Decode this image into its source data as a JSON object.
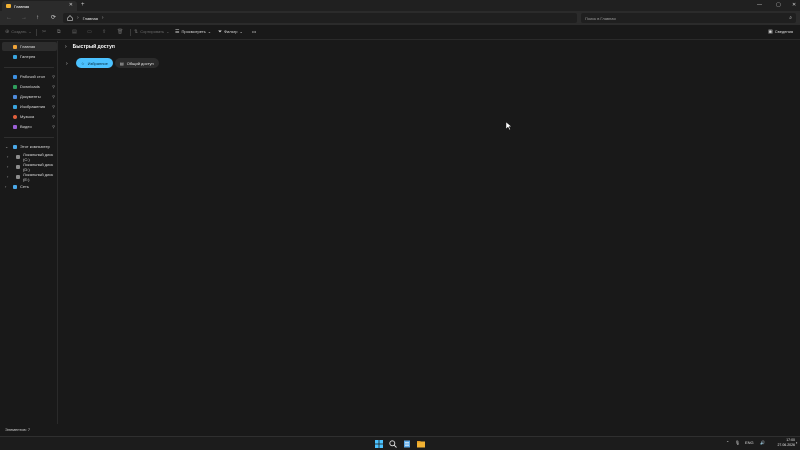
{
  "window": {
    "tab_title": "Главная",
    "tab_close": "✕",
    "new_tab": "+",
    "controls": {
      "minimize": "—",
      "maximize": "▢",
      "close": "✕"
    }
  },
  "addressbar": {
    "back": "←",
    "forward": "→",
    "up": "↑",
    "refresh": "⟳",
    "breadcrumb_sep": "›",
    "breadcrumb_label": "Главная",
    "search_placeholder": "Поиск в Главная",
    "search_icon": "search-icon"
  },
  "commandbar": {
    "new_label": "Создать",
    "sort_label": "Сортировать",
    "view_label": "Просмотреть",
    "filter_label": "Фильтр",
    "more": "•••",
    "details_label": "Сведения"
  },
  "sidebar": {
    "home": "Главная",
    "gallery": "Галерея",
    "pinned": [
      {
        "label": "Рабочий стол",
        "color": "#3d8fe0"
      },
      {
        "label": "Downloads",
        "color": "#2f9e5b"
      },
      {
        "label": "Документы",
        "color": "#4f8ad9"
      },
      {
        "label": "Изображения",
        "color": "#3aa4de"
      },
      {
        "label": "Музыка",
        "color": "#e0603d"
      },
      {
        "label": "Видео",
        "color": "#9b5fd6"
      }
    ],
    "this_pc": "Этот компьютер",
    "drives": [
      "Локальный диск (C:)",
      "Локальный диск (D:)",
      "Локальный диск (E:)"
    ],
    "network": "Сеть"
  },
  "main": {
    "section_title": "Быстрый доступ",
    "pill_favorites": "Избранное",
    "pill_shared": "Общий доступ"
  },
  "status": {
    "items_text": "Элементов: 7"
  },
  "taskbar": {
    "lang": "ENG",
    "time": "17:00",
    "date": "27.06.2026"
  },
  "colors": {
    "accent": "#4cc2ff",
    "folder": "#f2b233",
    "background": "#191919"
  }
}
